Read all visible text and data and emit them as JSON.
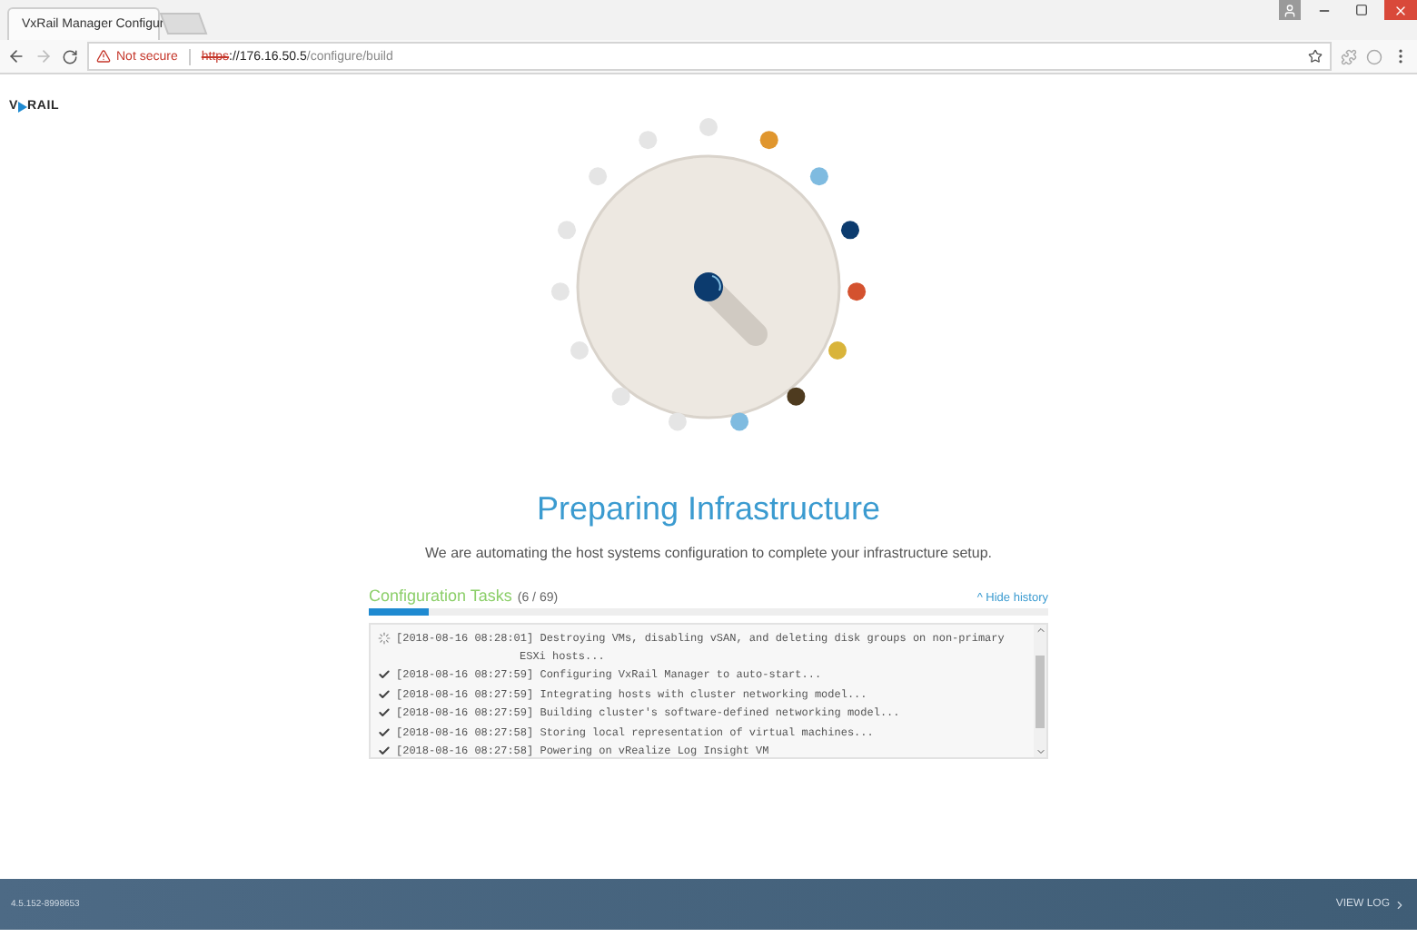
{
  "browser": {
    "tab_title": "VxRail Manager Configur",
    "security": "Not secure",
    "url_scheme": "https",
    "url_host": "://176.16.50.5",
    "url_path": "/configure/build"
  },
  "logo": {
    "left": "V",
    "right": "RAIL"
  },
  "dial": {
    "dots": [
      {
        "color": "#e5e5e5"
      },
      {
        "color": "#e0962e"
      },
      {
        "color": "#7fbbe0"
      },
      {
        "color": "#0c3b6e"
      },
      {
        "color": "#d4522f"
      },
      {
        "color": "#d9b43a"
      },
      {
        "color": "#4e3b1f"
      },
      {
        "color": "#7fbbe0"
      },
      {
        "color": "#e5e5e5"
      },
      {
        "color": "#e5e5e5"
      },
      {
        "color": "#e5e5e5"
      },
      {
        "color": "#e5e5e5"
      },
      {
        "color": "#e5e5e5"
      },
      {
        "color": "#e5e5e5"
      },
      {
        "color": "#e5e5e5"
      }
    ]
  },
  "title": "Preparing Infrastructure",
  "subtitle": "We are automating the host systems configuration to complete your infrastructure setup.",
  "tasks": {
    "heading": "Configuration Tasks",
    "count": "(6 / 69)",
    "toggle": "^ Hide history",
    "level": 0.087,
    "log": [
      {
        "kind": "running",
        "text": "[2018-08-16 08:28:01] Destroying VMs, disabling vSAN, and deleting disk groups on non-primary ESXi hosts..."
      },
      {
        "kind": "done",
        "text": "[2018-08-16 08:27:59] Configuring VxRail Manager to auto-start..."
      },
      {
        "kind": "done",
        "text": "[2018-08-16 08:27:59] Integrating hosts with cluster networking model..."
      },
      {
        "kind": "done",
        "text": "[2018-08-16 08:27:59] Building cluster's software-defined networking model..."
      },
      {
        "kind": "done",
        "text": "[2018-08-16 08:27:58] Storing local representation of virtual machines..."
      },
      {
        "kind": "done",
        "text": "[2018-08-16 08:27:58] Powering on vRealize Log Insight VM"
      }
    ]
  },
  "footer": {
    "version": "4.5.152-8998653",
    "view_log": "VIEW LOG"
  }
}
